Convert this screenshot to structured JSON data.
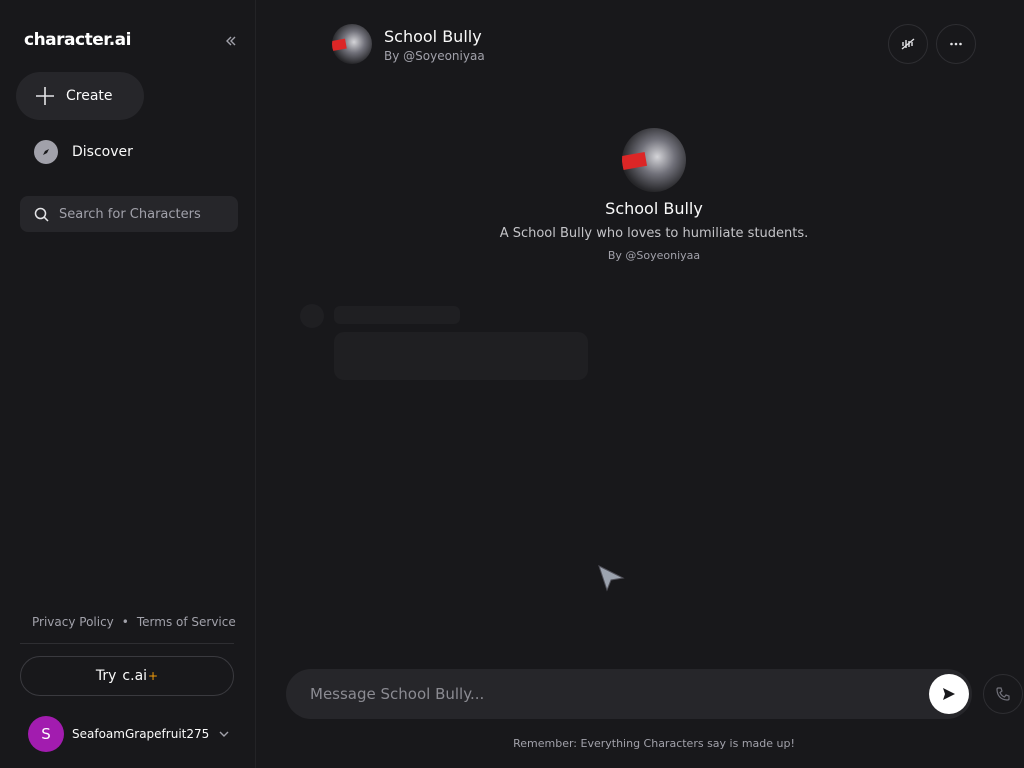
{
  "app": {
    "logo_text": "character.ai"
  },
  "sidebar": {
    "create_label": "Create",
    "discover_label": "Discover",
    "search_placeholder": "Search for Characters",
    "footer": {
      "privacy": "Privacy Policy",
      "separator": "•",
      "terms": "Terms of Service"
    },
    "try_label": "Try",
    "try_brand": "c.ai",
    "try_plus": "+",
    "user": {
      "initial": "S",
      "name": "SeafoamGrapefruit275"
    }
  },
  "header": {
    "character_name": "School Bully",
    "creator": "By @Soyeoniyaa"
  },
  "intro": {
    "name": "School Bully",
    "description": "A School Bully who loves to humiliate students.",
    "creator": "By @Soyeoniyaa"
  },
  "composer": {
    "placeholder": "Message School Bully...",
    "disclaimer": "Remember: Everything Characters say is made up!"
  },
  "icons": {
    "collapse": "double-chevron-left-icon",
    "create": "plus-icon",
    "discover": "compass-icon",
    "search": "search-icon",
    "user_menu": "chevron-down-icon",
    "voice": "voice-off-icon",
    "more": "more-horizontal-icon",
    "send": "send-icon",
    "call": "phone-icon"
  },
  "colors": {
    "background": "#18181b",
    "surface": "#26262a",
    "avatar_user": "#a21caf",
    "plus_accent": "#f59e0b"
  }
}
